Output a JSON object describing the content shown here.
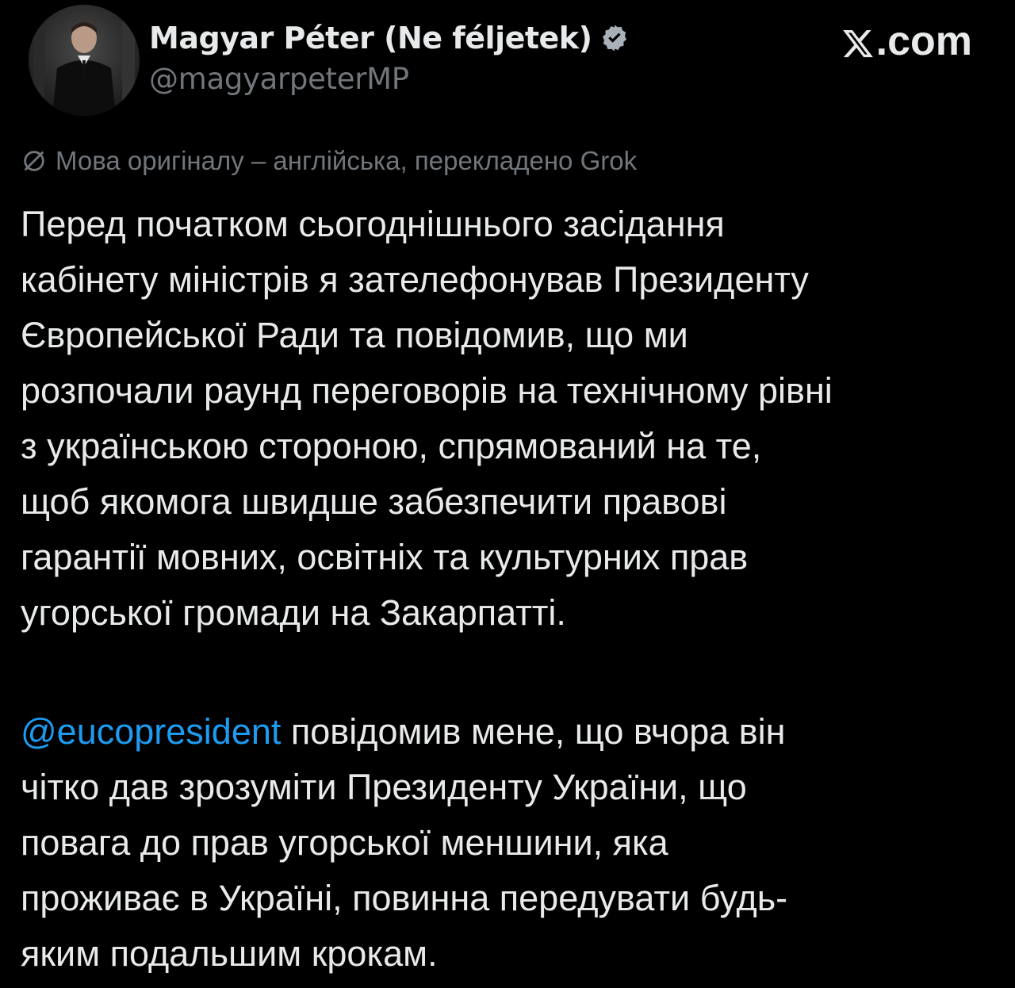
{
  "author": {
    "display_name": "Magyar Péter (Ne féljetek)",
    "handle": "@magyarpeterMP",
    "verified_icon": "verified-badge-icon",
    "avatar": "profile-photo"
  },
  "site": {
    "logo_icon": "x-logo-icon",
    "logo_suffix": ".com"
  },
  "translation_note": {
    "icon": "globe-slash-icon",
    "text": "Мова оригіналу – англійська, перекладено Grok"
  },
  "tweet": {
    "paragraph1": [
      "Перед початком сьогоднішнього засідання",
      "кабінету міністрів я зателефонував Президенту",
      "Європейської Ради та повідомив, що ми",
      "розпочали раунд переговорів на технічному рівні",
      "з українською стороною, спрямований на те,",
      "щоб якомога швидше забезпечити правові",
      "гарантії мовних, освітніх та культурних прав",
      "угорської громади на Закарпатті."
    ],
    "paragraph2_mention": "@eucopresident",
    "paragraph2_first_rest": " повідомив мене, що вчора він",
    "paragraph2": [
      "чітко дав зрозуміти Президенту України, що",
      "повага до прав угорської меншини, яка",
      "проживає в Україні, повинна передувати будь-",
      "яким подальшим крокам."
    ]
  },
  "colors": {
    "background": "#000000",
    "text": "#e7e9ea",
    "muted": "#71767b",
    "link": "#1d9bf0"
  }
}
